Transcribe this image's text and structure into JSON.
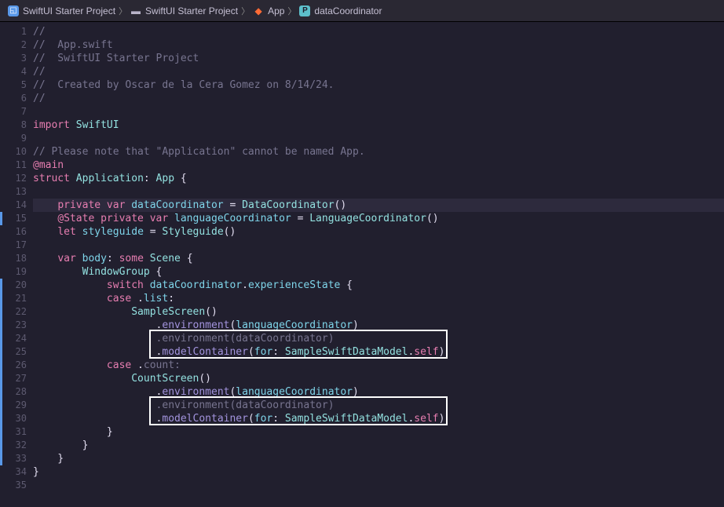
{
  "breadcrumb": [
    {
      "icon": "proj",
      "label": "SwiftUI Starter Project"
    },
    {
      "icon": "folder",
      "label": "SwiftUI Starter Project"
    },
    {
      "icon": "swift",
      "label": "App"
    },
    {
      "icon": "prop",
      "label": "dataCoordinator"
    }
  ],
  "code": {
    "lines": [
      {
        "num": 1,
        "tokens": [
          [
            "comment",
            "//"
          ]
        ]
      },
      {
        "num": 2,
        "tokens": [
          [
            "comment",
            "//  App.swift"
          ]
        ]
      },
      {
        "num": 3,
        "tokens": [
          [
            "comment",
            "//  SwiftUI Starter Project"
          ]
        ]
      },
      {
        "num": 4,
        "tokens": [
          [
            "comment",
            "//"
          ]
        ]
      },
      {
        "num": 5,
        "tokens": [
          [
            "comment",
            "//  Created by Oscar de la Cera Gomez on 8/14/24."
          ]
        ]
      },
      {
        "num": 6,
        "tokens": [
          [
            "comment",
            "//"
          ]
        ]
      },
      {
        "num": 7,
        "tokens": []
      },
      {
        "num": 8,
        "tokens": [
          [
            "keyword",
            "import"
          ],
          [
            "plain",
            " "
          ],
          [
            "type",
            "SwiftUI"
          ]
        ]
      },
      {
        "num": 9,
        "tokens": []
      },
      {
        "num": 10,
        "tokens": [
          [
            "comment",
            "// Please note that \"Application\" cannot be named App."
          ]
        ]
      },
      {
        "num": 11,
        "tokens": [
          [
            "keyword",
            "@main"
          ]
        ]
      },
      {
        "num": 12,
        "tokens": [
          [
            "keyword",
            "struct"
          ],
          [
            "plain",
            " "
          ],
          [
            "type",
            "Application"
          ],
          [
            "plain",
            ": "
          ],
          [
            "type",
            "App"
          ],
          [
            "plain",
            " {"
          ]
        ]
      },
      {
        "num": 13,
        "tokens": []
      },
      {
        "num": 14,
        "highlighted": true,
        "changeBar": true,
        "tokens": [
          [
            "plain",
            "    "
          ],
          [
            "keyword",
            "private var"
          ],
          [
            "plain",
            " "
          ],
          [
            "ident",
            "dataCoordinator"
          ],
          [
            "plain",
            " = "
          ],
          [
            "type",
            "DataCoordinator"
          ],
          [
            "plain",
            "()"
          ]
        ]
      },
      {
        "num": 15,
        "tokens": [
          [
            "plain",
            "    "
          ],
          [
            "keyword",
            "@State private var"
          ],
          [
            "plain",
            " "
          ],
          [
            "ident",
            "languageCoordinator"
          ],
          [
            "plain",
            " = "
          ],
          [
            "type",
            "LanguageCoordinator"
          ],
          [
            "plain",
            "()"
          ]
        ]
      },
      {
        "num": 16,
        "tokens": [
          [
            "plain",
            "    "
          ],
          [
            "keyword",
            "let"
          ],
          [
            "plain",
            " "
          ],
          [
            "ident",
            "styleguide"
          ],
          [
            "plain",
            " = "
          ],
          [
            "type",
            "Styleguide"
          ],
          [
            "plain",
            "()"
          ]
        ]
      },
      {
        "num": 17,
        "tokens": []
      },
      {
        "num": 18,
        "tokens": [
          [
            "plain",
            "    "
          ],
          [
            "keyword",
            "var"
          ],
          [
            "plain",
            " "
          ],
          [
            "ident",
            "body"
          ],
          [
            "plain",
            ": "
          ],
          [
            "keyword",
            "some"
          ],
          [
            "plain",
            " "
          ],
          [
            "type",
            "Scene"
          ],
          [
            "plain",
            " {"
          ]
        ]
      },
      {
        "num": 19,
        "changeBar": true,
        "tokens": [
          [
            "plain",
            "        "
          ],
          [
            "type",
            "WindowGroup"
          ],
          [
            "plain",
            " {"
          ]
        ]
      },
      {
        "num": 20,
        "changeBar": true,
        "tokens": [
          [
            "plain",
            "            "
          ],
          [
            "keyword",
            "switch"
          ],
          [
            "plain",
            " "
          ],
          [
            "ident",
            "dataCoordinator"
          ],
          [
            "plain",
            "."
          ],
          [
            "ident",
            "experienceState"
          ],
          [
            "plain",
            " {"
          ]
        ]
      },
      {
        "num": 21,
        "changeBar": true,
        "tokens": [
          [
            "plain",
            "            "
          ],
          [
            "keyword",
            "case"
          ],
          [
            "plain",
            " ."
          ],
          [
            "ident",
            "list"
          ],
          [
            "plain",
            ":"
          ]
        ]
      },
      {
        "num": 22,
        "changeBar": true,
        "tokens": [
          [
            "plain",
            "                "
          ],
          [
            "type",
            "SampleScreen"
          ],
          [
            "plain",
            "()"
          ]
        ]
      },
      {
        "num": 23,
        "changeBar": true,
        "tokens": [
          [
            "plain",
            "                    ."
          ],
          [
            "func",
            "environment"
          ],
          [
            "plain",
            "("
          ],
          [
            "ident",
            "languageCoordinator"
          ],
          [
            "plain",
            ")"
          ]
        ]
      },
      {
        "num": 24,
        "changeBar": true,
        "tokens": [
          [
            "plain",
            "                    "
          ],
          [
            "dim",
            ".environment(dataCoordinator)"
          ]
        ]
      },
      {
        "num": 25,
        "changeBar": true,
        "tokens": [
          [
            "plain",
            "                    ."
          ],
          [
            "func",
            "modelContainer"
          ],
          [
            "plain",
            "("
          ],
          [
            "ident",
            "for"
          ],
          [
            "plain",
            ": "
          ],
          [
            "type",
            "SampleSwiftDataModel"
          ],
          [
            "plain",
            "."
          ],
          [
            "keyword",
            "self"
          ],
          [
            "plain",
            ")"
          ]
        ]
      },
      {
        "num": 26,
        "changeBar": true,
        "tokens": [
          [
            "plain",
            "            "
          ],
          [
            "keyword",
            "case"
          ],
          [
            "plain",
            " ."
          ],
          [
            "dim",
            "count:"
          ]
        ]
      },
      {
        "num": 27,
        "changeBar": true,
        "tokens": [
          [
            "plain",
            "                "
          ],
          [
            "type",
            "CountScreen"
          ],
          [
            "plain",
            "()"
          ]
        ]
      },
      {
        "num": 28,
        "changeBar": true,
        "tokens": [
          [
            "plain",
            "                    ."
          ],
          [
            "func",
            "environment"
          ],
          [
            "plain",
            "("
          ],
          [
            "ident",
            "languageCoordinator"
          ],
          [
            "plain",
            ")"
          ]
        ]
      },
      {
        "num": 29,
        "changeBar": true,
        "tokens": [
          [
            "plain",
            "                    "
          ],
          [
            "dim",
            ".environment(dataCoordinator)"
          ]
        ]
      },
      {
        "num": 30,
        "changeBar": true,
        "tokens": [
          [
            "plain",
            "                    ."
          ],
          [
            "func",
            "modelContainer"
          ],
          [
            "plain",
            "("
          ],
          [
            "ident",
            "for"
          ],
          [
            "plain",
            ": "
          ],
          [
            "type",
            "SampleSwiftDataModel"
          ],
          [
            "plain",
            "."
          ],
          [
            "keyword",
            "self"
          ],
          [
            "plain",
            ")"
          ]
        ]
      },
      {
        "num": 31,
        "changeBar": true,
        "tokens": [
          [
            "plain",
            "            }"
          ]
        ]
      },
      {
        "num": 32,
        "changeBar": true,
        "tokens": [
          [
            "plain",
            "        }"
          ]
        ]
      },
      {
        "num": 33,
        "tokens": [
          [
            "plain",
            "    }"
          ]
        ]
      },
      {
        "num": 34,
        "tokens": [
          [
            "plain",
            "}"
          ]
        ]
      },
      {
        "num": 35,
        "tokens": []
      }
    ]
  },
  "overlays": [
    {
      "top_line": 24,
      "height_lines": 2
    },
    {
      "top_line": 29,
      "height_lines": 2
    }
  ]
}
